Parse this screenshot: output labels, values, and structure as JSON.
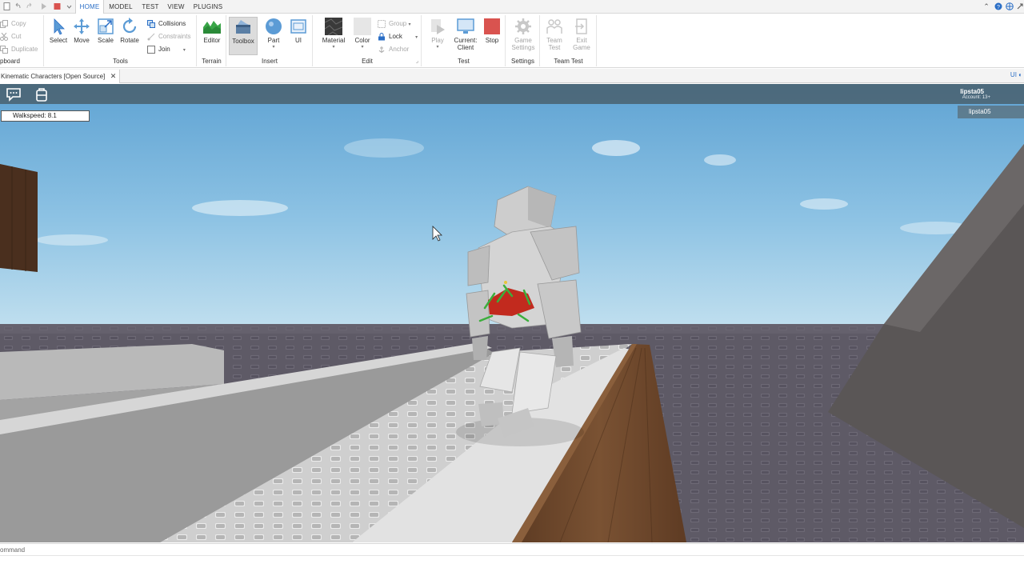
{
  "menu": {
    "tabs": [
      "HOME",
      "MODEL",
      "TEST",
      "VIEW",
      "PLUGINS"
    ],
    "active": "HOME"
  },
  "ribbon": {
    "clipboard": {
      "items": [
        "Copy",
        "Cut",
        "Duplicate"
      ],
      "label": "Clipboard",
      "label_visible": "pboard"
    },
    "tools": {
      "items": [
        "Select",
        "Move",
        "Scale",
        "Rotate"
      ],
      "options": [
        "Collisions",
        "Constraints",
        "Join"
      ],
      "label": "Tools"
    },
    "terrain": {
      "items": [
        "Editor"
      ],
      "label": "Terrain"
    },
    "insert": {
      "items": [
        "Toolbox",
        "Part",
        "UI"
      ],
      "label": "Insert"
    },
    "edit": {
      "items": [
        "Material",
        "Color"
      ],
      "options": [
        "Group",
        "Lock",
        "Anchor"
      ],
      "label": "Edit"
    },
    "test": {
      "items": [
        "Play",
        "Current:",
        "Client",
        "Stop"
      ],
      "label": "Test"
    },
    "settings": {
      "items": [
        "Game",
        "Settings"
      ],
      "label": "Settings"
    },
    "team_test": {
      "items": [
        "Team",
        "Test",
        "Exit",
        "Game"
      ],
      "label": "Team Test"
    }
  },
  "document": {
    "tab_title": "Kinematic Characters [Open Source]",
    "close": "✕",
    "ui_toggle": "UI"
  },
  "viewport": {
    "walkspeed": "Walkspeed: 8.1",
    "username": "lipsta05",
    "account": "Account: 13+",
    "player_list": [
      "lipsta05"
    ]
  },
  "command": {
    "label_visible": "ommand",
    "label": "Command",
    "value": ""
  },
  "colors": {
    "accent": "#2a6ec6",
    "sky_top": "#6aa8d4",
    "sky_bottom": "#b7d8ea",
    "baseplate": "#5e5a66",
    "wood": "#6a4327",
    "stop": "#d9534f",
    "terrain_green": "#3aa648"
  }
}
